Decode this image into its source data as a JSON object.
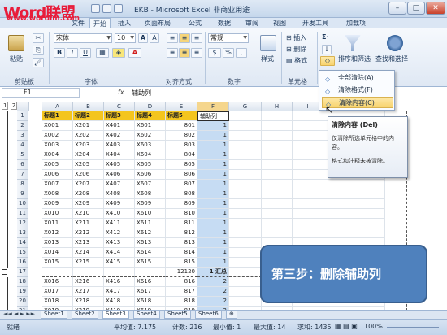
{
  "window": {
    "title": "EKB - Microsoft Excel 非商业用途",
    "logo": "Word联盟",
    "logo_url": "www.wordlm.com",
    "controls": [
      "–",
      "□",
      "✕"
    ]
  },
  "tabs": [
    "文件",
    "开始",
    "插入",
    "页面布局",
    "公式",
    "数据",
    "审阅",
    "视图",
    "开发工具",
    "加载项"
  ],
  "active_tab": "开始",
  "ribbon": {
    "clipboard": {
      "paste": "粘贴",
      "label": "剪贴板"
    },
    "font": {
      "name": "宋体",
      "size": "10",
      "bold": "B",
      "italic": "I",
      "underline": "U",
      "grow": "A",
      "shrink": "A",
      "color": "A",
      "label": "字体"
    },
    "alignment": {
      "label": "对齐方式"
    },
    "number": {
      "format": "常规",
      "label": "数字"
    },
    "styles": {
      "label": "样式"
    },
    "cells": {
      "insert": "插入",
      "delete": "删除",
      "format": "格式",
      "label": "单元格"
    },
    "editing": {
      "sort": "排序和筛选",
      "find": "查找和选择"
    }
  },
  "formula_bar": {
    "name_box": "F1",
    "fx": "fx",
    "value": "辅助列"
  },
  "sheet": {
    "outline_levels": [
      "1",
      "2",
      "3"
    ],
    "columns": [
      "A",
      "B",
      "C",
      "D",
      "E",
      "F",
      "G",
      "H",
      "I",
      "J",
      "K",
      "L"
    ],
    "headers": [
      "标题1",
      "标题2",
      "标题3",
      "标题4",
      "标题5",
      "辅助列"
    ],
    "rows": [
      {
        "r": "1",
        "cells": [
          "标题1",
          "标题2",
          "标题3",
          "标题4",
          "标题5",
          "辅助列"
        ]
      },
      {
        "r": "2",
        "cells": [
          "X001",
          "X201",
          "X401",
          "X601",
          "801",
          "1"
        ]
      },
      {
        "r": "3",
        "cells": [
          "X002",
          "X202",
          "X402",
          "X602",
          "802",
          "1"
        ]
      },
      {
        "r": "4",
        "cells": [
          "X003",
          "X203",
          "X403",
          "X603",
          "803",
          "1"
        ]
      },
      {
        "r": "5",
        "cells": [
          "X004",
          "X204",
          "X404",
          "X604",
          "804",
          "1"
        ]
      },
      {
        "r": "6",
        "cells": [
          "X005",
          "X205",
          "X405",
          "X605",
          "805",
          "1"
        ]
      },
      {
        "r": "7",
        "cells": [
          "X006",
          "X206",
          "X406",
          "X606",
          "806",
          "1"
        ]
      },
      {
        "r": "8",
        "cells": [
          "X007",
          "X207",
          "X407",
          "X607",
          "807",
          "1"
        ]
      },
      {
        "r": "9",
        "cells": [
          "X008",
          "X208",
          "X408",
          "X608",
          "808",
          "1"
        ]
      },
      {
        "r": "10",
        "cells": [
          "X009",
          "X209",
          "X409",
          "X609",
          "809",
          "1"
        ]
      },
      {
        "r": "11",
        "cells": [
          "X010",
          "X210",
          "X410",
          "X610",
          "810",
          "1"
        ]
      },
      {
        "r": "12",
        "cells": [
          "X011",
          "X211",
          "X411",
          "X611",
          "811",
          "1"
        ]
      },
      {
        "r": "13",
        "cells": [
          "X012",
          "X212",
          "X412",
          "X612",
          "812",
          "1"
        ]
      },
      {
        "r": "14",
        "cells": [
          "X013",
          "X213",
          "X413",
          "X613",
          "813",
          "1"
        ]
      },
      {
        "r": "15",
        "cells": [
          "X014",
          "X214",
          "X414",
          "X614",
          "814",
          "1"
        ]
      },
      {
        "r": "16",
        "cells": [
          "X015",
          "X215",
          "X415",
          "X615",
          "815",
          "1"
        ]
      },
      {
        "r": "17",
        "cells": [
          "",
          "",
          "",
          "",
          "12120",
          "1 汇总"
        ]
      },
      {
        "r": "18",
        "cells": [
          "X016",
          "X216",
          "X416",
          "X616",
          "816",
          "2"
        ]
      },
      {
        "r": "19",
        "cells": [
          "X017",
          "X217",
          "X417",
          "X617",
          "817",
          "2"
        ]
      },
      {
        "r": "20",
        "cells": [
          "X018",
          "X218",
          "X418",
          "X618",
          "818",
          "2"
        ]
      },
      {
        "r": "21",
        "cells": [
          "X019",
          "X219",
          "X419",
          "X619",
          "819",
          "2"
        ]
      }
    ]
  },
  "clear_menu": {
    "items": [
      "全部清除(A)",
      "清除格式(F)",
      "清除内容(C)"
    ],
    "highlighted": 2
  },
  "tooltip": {
    "title": "清除内容 (Del)",
    "body": "仅清除所选单元格中的内容。",
    "note": "格式和注释未被清除。"
  },
  "callout": "第三步：删除辅助列",
  "sheet_tabs": [
    "Sheet1",
    "Sheet2",
    "Sheet3",
    "Sheet4",
    "Sheet5",
    "Sheet6"
  ],
  "active_sheet": "Sheet3",
  "status": {
    "mode": "就绪",
    "average": "平均值: 7.175",
    "count": "计数: 216",
    "min": "最小值: 1",
    "max": "最大值: 14",
    "sum": "求和: 1435",
    "zoom": "100%"
  },
  "colors": {
    "header_fill": "#f4c51e",
    "selection": "#c6dcf3",
    "callout": "#4f81bd"
  }
}
